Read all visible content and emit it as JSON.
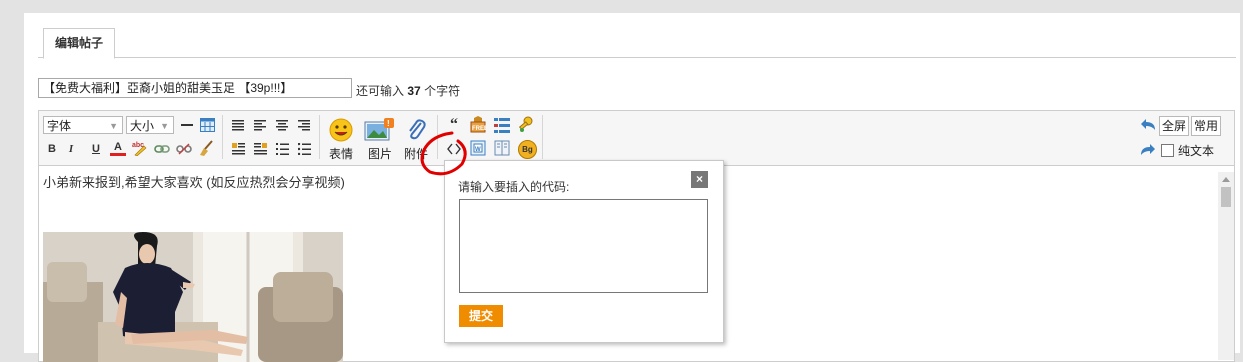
{
  "tabs": [
    {
      "label": "编辑帖子"
    }
  ],
  "subject": {
    "value": "【免费大福利】亞裔小姐的甜美玉足 【39p!!!】"
  },
  "remaining": {
    "prefix": "还可输入",
    "count": "37",
    "suffix": "个字符"
  },
  "toolbar": {
    "font_label": "字体",
    "size_label": "大小",
    "bold": "B",
    "italic": "I",
    "underline": "U",
    "forecolor": "A",
    "quote": "“",
    "bg": "Bg",
    "smiley_label": "表情",
    "image_label": "图片",
    "attach_label": "附件",
    "fullscreen_label": "全屏",
    "common_label": "常用",
    "plaintext_label": "纯文本"
  },
  "content": {
    "text": "小弟新来报到,希望大家喜欢 (如反应热烈会分享视频)"
  },
  "code_popup": {
    "title": "请输入要插入的代码:",
    "close": "×",
    "textarea_value": "",
    "submit_label": "提交"
  },
  "colors": {
    "accent": "#f08c00",
    "annotation": "#e00000"
  }
}
